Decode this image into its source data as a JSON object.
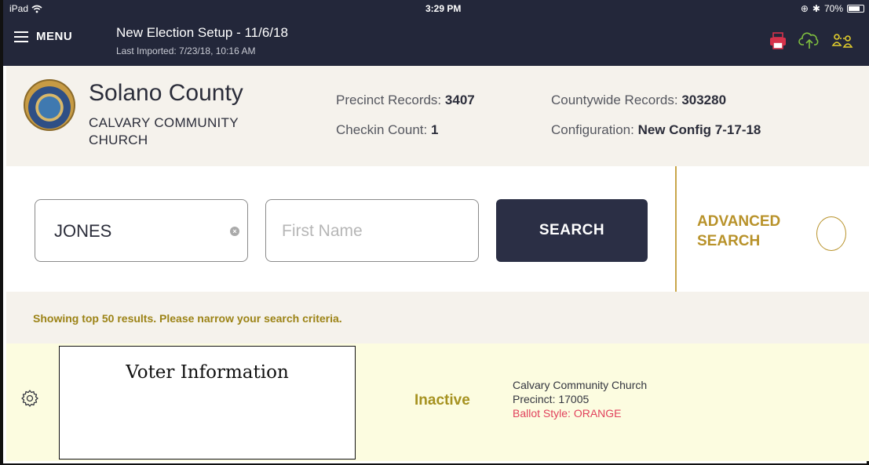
{
  "status_bar": {
    "device": "iPad",
    "time": "3:29 PM",
    "battery": "70%"
  },
  "topbar": {
    "menu_label": "MENU",
    "election_title": "New Election Setup - 11/6/18",
    "last_imported": "Last Imported: 7/23/18, 10:16 AM",
    "icons": [
      "printer-icon",
      "cloud-upload-icon",
      "users-sync-icon"
    ],
    "icon_colors": {
      "printer": "#d6324b",
      "cloud": "#7fbf3f",
      "users": "#e3cf2c"
    }
  },
  "header": {
    "county": "Solano County",
    "site": "CALVARY COMMUNITY CHURCH",
    "precinct_records_label": "Precinct Records:",
    "precinct_records_value": "3407",
    "checkin_count_label": "Checkin Count:",
    "checkin_count_value": "1",
    "countywide_records_label": "Countywide Records:",
    "countywide_records_value": "303280",
    "configuration_label": "Configuration:",
    "configuration_value": "New Config 7-17-18"
  },
  "search": {
    "last_name_value": "JONES",
    "first_name_placeholder": "First Name",
    "search_button": "SEARCH",
    "advanced_label_line1": "ADVANCED",
    "advanced_label_line2": "SEARCH"
  },
  "notice": "Showing top 50 results. Please narrow your search criteria.",
  "result": {
    "voter_info": "Voter Information",
    "status": "Inactive",
    "location": "Calvary Community Church",
    "precinct": "Precinct: 17005",
    "ballot_style": "Ballot Style: ORANGE"
  },
  "colors": {
    "topbar_bg": "#23273a",
    "accent_gold": "#b8922a",
    "search_button_bg": "#2b2f45",
    "ballot_style": "#e1415c",
    "result_bg": "#fcfce0"
  }
}
